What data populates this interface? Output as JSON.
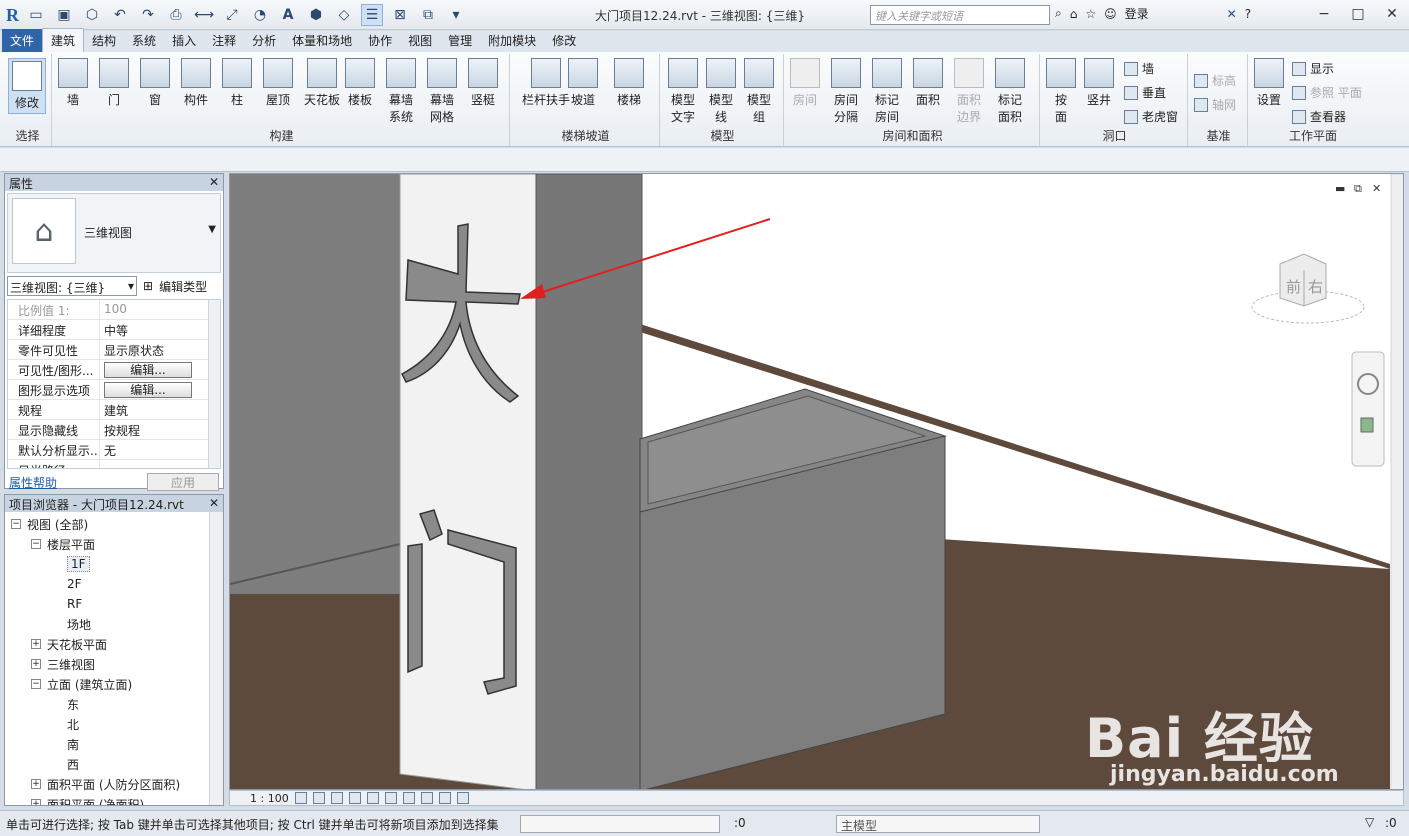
{
  "app": {
    "title": "大门项目12.24.rvt - 三维视图: {三维}",
    "search_placeholder": "键入关键字或短语",
    "login": "登录"
  },
  "tabs": [
    "文件",
    "建筑",
    "结构",
    "系统",
    "插入",
    "注释",
    "分析",
    "体量和场地",
    "协作",
    "视图",
    "管理",
    "附加模块",
    "修改"
  ],
  "active_tab": "建筑",
  "ribbon": {
    "select": {
      "modify": "修改",
      "title": "选择"
    },
    "build": {
      "items": [
        "墙",
        "门",
        "窗",
        "构件",
        "柱",
        "屋顶",
        "天花板",
        "楼板",
        "幕墙\n系统",
        "幕墙\n网格",
        "竖梃"
      ],
      "title": "构建"
    },
    "stairs": {
      "items": [
        "栏杆扶手",
        "坡道",
        "楼梯"
      ],
      "title": "楼梯坡道"
    },
    "model": {
      "items": [
        "模型\n文字",
        "模型\n线",
        "模型\n组"
      ],
      "title": "模型"
    },
    "room": {
      "items": [
        "房间",
        "房间\n分隔",
        "标记\n房间",
        "面积",
        "面积\n边界",
        "标记\n面积"
      ],
      "title": "房间和面积"
    },
    "opening": {
      "items": [
        "按\n面",
        "竖井"
      ],
      "small": [
        "墙",
        "垂直",
        "老虎窗"
      ],
      "title": "洞口"
    },
    "datum": {
      "small": [
        "标高",
        "轴网"
      ],
      "title": "基准"
    },
    "workplane": {
      "setting": "设置",
      "small": [
        "显示",
        "参照 平面",
        "查看器"
      ],
      "title": "工作平面"
    }
  },
  "properties": {
    "header": "属性",
    "type_name": "三维视图",
    "selector": "三维视图: {三维}",
    "edit_type": "编辑类型",
    "rows": [
      {
        "k": "比例值 1:",
        "v": "100",
        "dim": true
      },
      {
        "k": "详细程度",
        "v": "中等"
      },
      {
        "k": "零件可见性",
        "v": "显示原状态"
      },
      {
        "k": "可见性/图形...",
        "btn": "编辑..."
      },
      {
        "k": "图形显示选项",
        "btn": "编辑..."
      },
      {
        "k": "规程",
        "v": "建筑"
      },
      {
        "k": "显示隐藏线",
        "v": "按规程"
      },
      {
        "k": "默认分析显示...",
        "v": "无"
      },
      {
        "k": "日光路径",
        "v": ""
      }
    ],
    "help": "属性帮助",
    "apply": "应用"
  },
  "browser": {
    "header": "项目浏览器 - 大门项目12.24.rvt",
    "nodes": [
      {
        "label": "视图 (全部)",
        "level": 0,
        "toggle": "−"
      },
      {
        "label": "楼层平面",
        "level": 1,
        "toggle": "−"
      },
      {
        "label": "1F",
        "level": 2,
        "hl": true
      },
      {
        "label": "2F",
        "level": 2
      },
      {
        "label": "RF",
        "level": 2
      },
      {
        "label": "场地",
        "level": 2
      },
      {
        "label": "天花板平面",
        "level": 1,
        "toggle": "+"
      },
      {
        "label": "三维视图",
        "level": 1,
        "toggle": "+"
      },
      {
        "label": "立面 (建筑立面)",
        "level": 1,
        "toggle": "−"
      },
      {
        "label": "东",
        "level": 2
      },
      {
        "label": "北",
        "level": 2
      },
      {
        "label": "南",
        "level": 2
      },
      {
        "label": "西",
        "level": 2
      },
      {
        "label": "面积平面 (人防分区面积)",
        "level": 1,
        "toggle": "+"
      },
      {
        "label": "面积平面 (净面积)",
        "level": 1,
        "toggle": "+"
      }
    ]
  },
  "viewport": {
    "scale": "1 : 100",
    "cube_front": "前",
    "cube_right": "右",
    "model_text_1": "大",
    "model_text_2": "门"
  },
  "status": {
    "text": "单击可进行选择; 按 Tab 键并单击可选择其他项目; 按 Ctrl 键并单击可将新项目添加到选择集",
    "count": ":0",
    "model": "主模型",
    "filter": ":0"
  },
  "watermark": {
    "brand": "Bai  经验",
    "url": "jingyan.baidu.com"
  }
}
